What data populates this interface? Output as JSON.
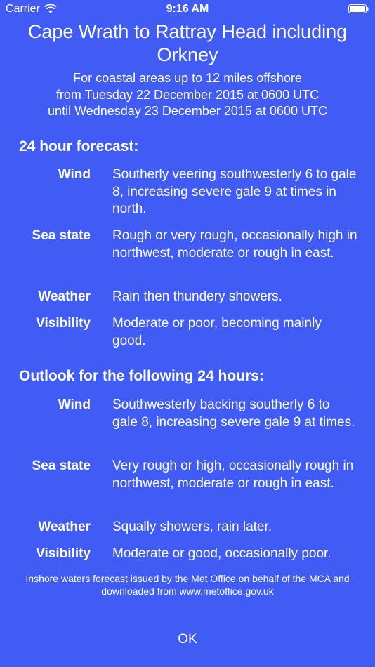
{
  "status_bar": {
    "carrier": "Carrier",
    "time": "9:16 AM"
  },
  "header": {
    "title_line1": "Cape Wrath to Rattray Head including",
    "title_line2": "Orkney",
    "subtitle_lines": [
      "For coastal areas up to 12 miles offshore",
      "from Tuesday 22 December 2015 at 0600 UTC",
      "until Wednesday 23 December 2015 at 0600 UTC"
    ]
  },
  "forecast": {
    "heading": "24 hour forecast:",
    "rows": [
      {
        "label": "Wind",
        "value": "Southerly veering southwesterly 6 to gale 8, increasing severe gale 9 at times in north."
      },
      {
        "label": "Sea state",
        "value": "Rough or very rough, occasionally high in northwest, moderate or rough in east."
      },
      {
        "label": "Weather",
        "value": "Rain then thundery showers."
      },
      {
        "label": "Visibility",
        "value": "Moderate or poor, becoming mainly good."
      }
    ]
  },
  "outlook": {
    "heading": "Outlook for the following 24 hours:",
    "rows": [
      {
        "label": "Wind",
        "value": "Southwesterly backing southerly 6 to gale 8, increasing severe gale 9 at times."
      },
      {
        "label": "Sea state",
        "value": "Very rough or high, occasionally rough in northwest, moderate or rough in east."
      },
      {
        "label": "Weather",
        "value": "Squally showers, rain later."
      },
      {
        "label": "Visibility",
        "value": "Moderate or good, occasionally poor."
      }
    ]
  },
  "footnote": "Inshore waters forecast issued by the Met Office on behalf of the MCA and downloaded from www.metoffice.gov.uk",
  "ok_label": "OK",
  "colors": {
    "background": "#405cf5",
    "text": "#ffffff"
  }
}
